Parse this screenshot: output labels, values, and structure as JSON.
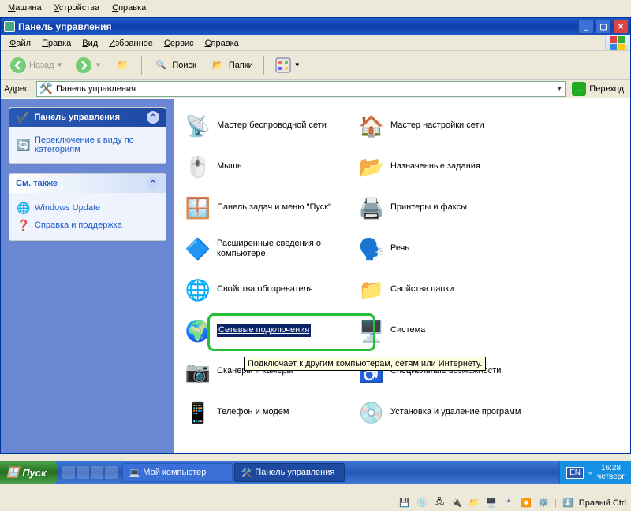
{
  "vm_menu": {
    "machine": "Машина",
    "devices": "Устройства",
    "help": "Справка"
  },
  "window": {
    "title": "Панель управления",
    "menu": {
      "file": "Файл",
      "edit": "Правка",
      "view": "Вид",
      "favorites": "Избранное",
      "tools": "Сервис",
      "help": "Справка"
    },
    "toolbar": {
      "back": "Назад",
      "search": "Поиск",
      "folders": "Папки"
    },
    "address": {
      "label": "Адрес:",
      "value": "Панель управления",
      "go": "Переход"
    }
  },
  "side": {
    "panel_title": "Панель управления",
    "switch_view": "Переключение к виду по категориям",
    "see_also": "См. также",
    "win_update": "Windows Update",
    "help_support": "Справка и поддержка"
  },
  "items_left": [
    {
      "id": "wireless-wizard",
      "label": "Мастер беспроводной сети",
      "icon": "📡"
    },
    {
      "id": "mouse",
      "label": "Мышь",
      "icon": "🖱️"
    },
    {
      "id": "taskbar-start",
      "label": "Панель задач и меню \"Пуск\"",
      "icon": "🪟"
    },
    {
      "id": "system-info",
      "label": "Расширенные сведения о компьютере",
      "icon": "🔷"
    },
    {
      "id": "internet-options",
      "label": "Свойства обозревателя",
      "icon": "🌐"
    },
    {
      "id": "network-connections",
      "label": "Сетевые подключения",
      "icon": "🌍",
      "selected": true
    },
    {
      "id": "scanners-cameras",
      "label": "Сканеры и камеры",
      "icon": "📷"
    },
    {
      "id": "phone-modem",
      "label": "Телефон и модем",
      "icon": "📱"
    }
  ],
  "items_right": [
    {
      "id": "network-wizard",
      "label": "Мастер настройки сети",
      "icon": "🏠"
    },
    {
      "id": "scheduled-tasks",
      "label": "Назначенные задания",
      "icon": "📂"
    },
    {
      "id": "printers-faxes",
      "label": "Принтеры и факсы",
      "icon": "🖨️"
    },
    {
      "id": "speech",
      "label": "Речь",
      "icon": "🗣️"
    },
    {
      "id": "folder-options",
      "label": "Свойства папки",
      "icon": "📁"
    },
    {
      "id": "system",
      "label": "Система",
      "icon": "🖥️"
    },
    {
      "id": "accessibility",
      "label": "Специальные возможности",
      "icon": "♿"
    },
    {
      "id": "add-remove-programs",
      "label": "Установка и удаление программ",
      "icon": "💿"
    }
  ],
  "tooltip": "Подключает к другим компьютерам, сетям или Интернету.",
  "taskbar": {
    "start": "Пуск",
    "task1": "Мой компьютер",
    "task2": "Панель управления",
    "lang": "EN",
    "time": "16:28",
    "day": "четверг"
  },
  "vm_status": {
    "host_key": "Правый Ctrl"
  }
}
